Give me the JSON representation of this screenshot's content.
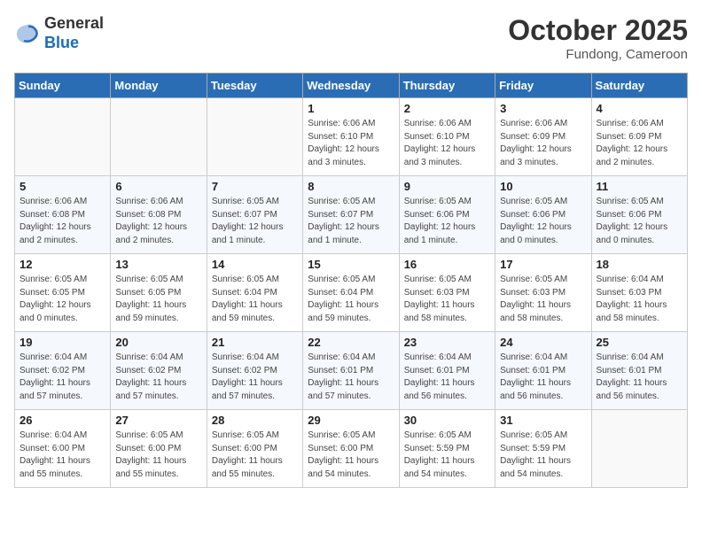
{
  "header": {
    "logo_general": "General",
    "logo_blue": "Blue",
    "month": "October 2025",
    "location": "Fundong, Cameroon"
  },
  "weekdays": [
    "Sunday",
    "Monday",
    "Tuesday",
    "Wednesday",
    "Thursday",
    "Friday",
    "Saturday"
  ],
  "weeks": [
    [
      {
        "day": "",
        "info": ""
      },
      {
        "day": "",
        "info": ""
      },
      {
        "day": "",
        "info": ""
      },
      {
        "day": "1",
        "info": "Sunrise: 6:06 AM\nSunset: 6:10 PM\nDaylight: 12 hours\nand 3 minutes."
      },
      {
        "day": "2",
        "info": "Sunrise: 6:06 AM\nSunset: 6:10 PM\nDaylight: 12 hours\nand 3 minutes."
      },
      {
        "day": "3",
        "info": "Sunrise: 6:06 AM\nSunset: 6:09 PM\nDaylight: 12 hours\nand 3 minutes."
      },
      {
        "day": "4",
        "info": "Sunrise: 6:06 AM\nSunset: 6:09 PM\nDaylight: 12 hours\nand 2 minutes."
      }
    ],
    [
      {
        "day": "5",
        "info": "Sunrise: 6:06 AM\nSunset: 6:08 PM\nDaylight: 12 hours\nand 2 minutes."
      },
      {
        "day": "6",
        "info": "Sunrise: 6:06 AM\nSunset: 6:08 PM\nDaylight: 12 hours\nand 2 minutes."
      },
      {
        "day": "7",
        "info": "Sunrise: 6:05 AM\nSunset: 6:07 PM\nDaylight: 12 hours\nand 1 minute."
      },
      {
        "day": "8",
        "info": "Sunrise: 6:05 AM\nSunset: 6:07 PM\nDaylight: 12 hours\nand 1 minute."
      },
      {
        "day": "9",
        "info": "Sunrise: 6:05 AM\nSunset: 6:06 PM\nDaylight: 12 hours\nand 1 minute."
      },
      {
        "day": "10",
        "info": "Sunrise: 6:05 AM\nSunset: 6:06 PM\nDaylight: 12 hours\nand 0 minutes."
      },
      {
        "day": "11",
        "info": "Sunrise: 6:05 AM\nSunset: 6:06 PM\nDaylight: 12 hours\nand 0 minutes."
      }
    ],
    [
      {
        "day": "12",
        "info": "Sunrise: 6:05 AM\nSunset: 6:05 PM\nDaylight: 12 hours\nand 0 minutes."
      },
      {
        "day": "13",
        "info": "Sunrise: 6:05 AM\nSunset: 6:05 PM\nDaylight: 11 hours\nand 59 minutes."
      },
      {
        "day": "14",
        "info": "Sunrise: 6:05 AM\nSunset: 6:04 PM\nDaylight: 11 hours\nand 59 minutes."
      },
      {
        "day": "15",
        "info": "Sunrise: 6:05 AM\nSunset: 6:04 PM\nDaylight: 11 hours\nand 59 minutes."
      },
      {
        "day": "16",
        "info": "Sunrise: 6:05 AM\nSunset: 6:03 PM\nDaylight: 11 hours\nand 58 minutes."
      },
      {
        "day": "17",
        "info": "Sunrise: 6:05 AM\nSunset: 6:03 PM\nDaylight: 11 hours\nand 58 minutes."
      },
      {
        "day": "18",
        "info": "Sunrise: 6:04 AM\nSunset: 6:03 PM\nDaylight: 11 hours\nand 58 minutes."
      }
    ],
    [
      {
        "day": "19",
        "info": "Sunrise: 6:04 AM\nSunset: 6:02 PM\nDaylight: 11 hours\nand 57 minutes."
      },
      {
        "day": "20",
        "info": "Sunrise: 6:04 AM\nSunset: 6:02 PM\nDaylight: 11 hours\nand 57 minutes."
      },
      {
        "day": "21",
        "info": "Sunrise: 6:04 AM\nSunset: 6:02 PM\nDaylight: 11 hours\nand 57 minutes."
      },
      {
        "day": "22",
        "info": "Sunrise: 6:04 AM\nSunset: 6:01 PM\nDaylight: 11 hours\nand 57 minutes."
      },
      {
        "day": "23",
        "info": "Sunrise: 6:04 AM\nSunset: 6:01 PM\nDaylight: 11 hours\nand 56 minutes."
      },
      {
        "day": "24",
        "info": "Sunrise: 6:04 AM\nSunset: 6:01 PM\nDaylight: 11 hours\nand 56 minutes."
      },
      {
        "day": "25",
        "info": "Sunrise: 6:04 AM\nSunset: 6:01 PM\nDaylight: 11 hours\nand 56 minutes."
      }
    ],
    [
      {
        "day": "26",
        "info": "Sunrise: 6:04 AM\nSunset: 6:00 PM\nDaylight: 11 hours\nand 55 minutes."
      },
      {
        "day": "27",
        "info": "Sunrise: 6:05 AM\nSunset: 6:00 PM\nDaylight: 11 hours\nand 55 minutes."
      },
      {
        "day": "28",
        "info": "Sunrise: 6:05 AM\nSunset: 6:00 PM\nDaylight: 11 hours\nand 55 minutes."
      },
      {
        "day": "29",
        "info": "Sunrise: 6:05 AM\nSunset: 6:00 PM\nDaylight: 11 hours\nand 54 minutes."
      },
      {
        "day": "30",
        "info": "Sunrise: 6:05 AM\nSunset: 5:59 PM\nDaylight: 11 hours\nand 54 minutes."
      },
      {
        "day": "31",
        "info": "Sunrise: 6:05 AM\nSunset: 5:59 PM\nDaylight: 11 hours\nand 54 minutes."
      },
      {
        "day": "",
        "info": ""
      }
    ]
  ]
}
